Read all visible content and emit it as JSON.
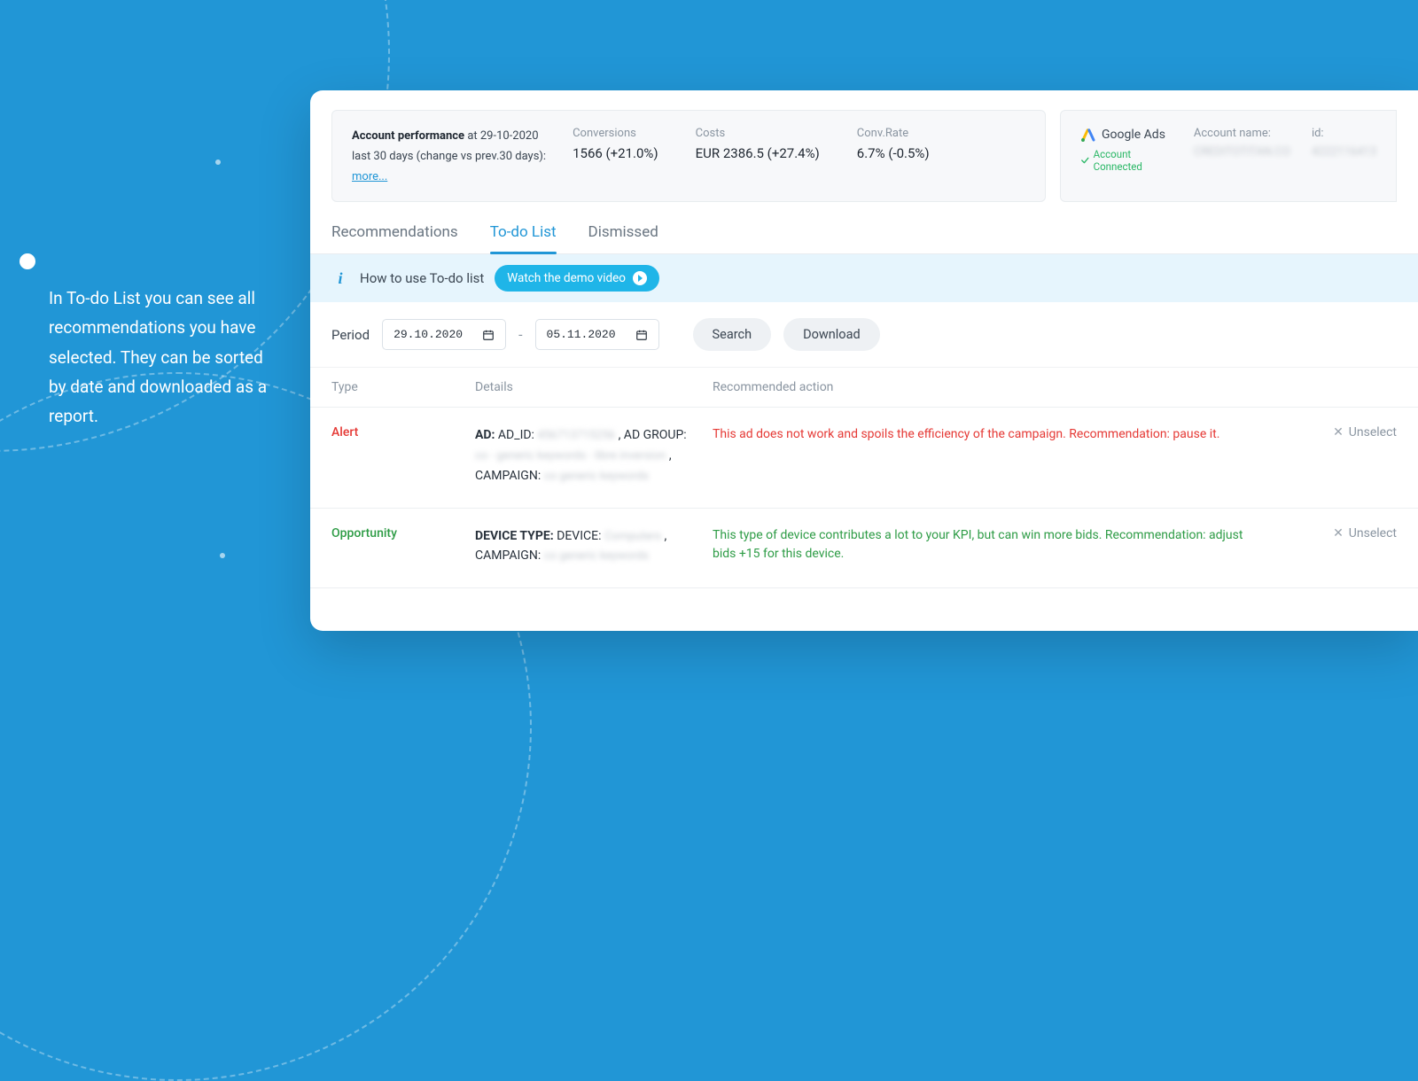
{
  "sidebar_caption": "In To-do List you can see all recommendations you have selected. They can be sorted by date and downloaded as a report.",
  "perf": {
    "title_bold": "Account performance",
    "title_tail": "at 29-10-2020",
    "subtitle": "last 30 days (change vs prev.30 days):",
    "more": "more...",
    "metrics": [
      {
        "label": "Conversions",
        "value": "1566 (+21.0%)"
      },
      {
        "label": "Costs",
        "value": "EUR 2386.5 (+27.4%)"
      },
      {
        "label": "Conv.Rate",
        "value": "6.7% (-0.5%)"
      }
    ]
  },
  "account": {
    "provider": "Google Ads",
    "status": "Account Connected",
    "name_label": "Account name:",
    "name_value": "CREDITOTITAN.CO",
    "id_label": "id:",
    "id_value": "4222116413"
  },
  "tabs": {
    "recommendations": "Recommendations",
    "todo": "To-do List",
    "dismissed": "Dismissed"
  },
  "info": {
    "text": "How to use To-do list",
    "demo_btn": "Watch the demo video"
  },
  "period": {
    "label": "Period",
    "from": "29.10.2020",
    "to": "05.11.2020",
    "search": "Search",
    "download": "Download"
  },
  "table": {
    "headers": {
      "type": "Type",
      "details": "Details",
      "action": "Recommended action"
    },
    "rows": [
      {
        "type": "Alert",
        "details_plain": "AD: AD_ID: 456713715256 , AD GROUP: co - generic keywords - libre inversion , CAMPAIGN: co generic keywords",
        "action": "This ad does not work and spoils the efficiency of the campaign. Recommendation: pause it.",
        "unselect": "Unselect"
      },
      {
        "type": "Opportunity",
        "details_plain": "DEVICE TYPE: DEVICE: Computers , CAMPAIGN: co generic keywords",
        "action": "This type of device contributes a lot to your KPI, but can win more bids. Recommendation: adjust bids +15 for this device.",
        "unselect": "Unselect"
      }
    ]
  }
}
